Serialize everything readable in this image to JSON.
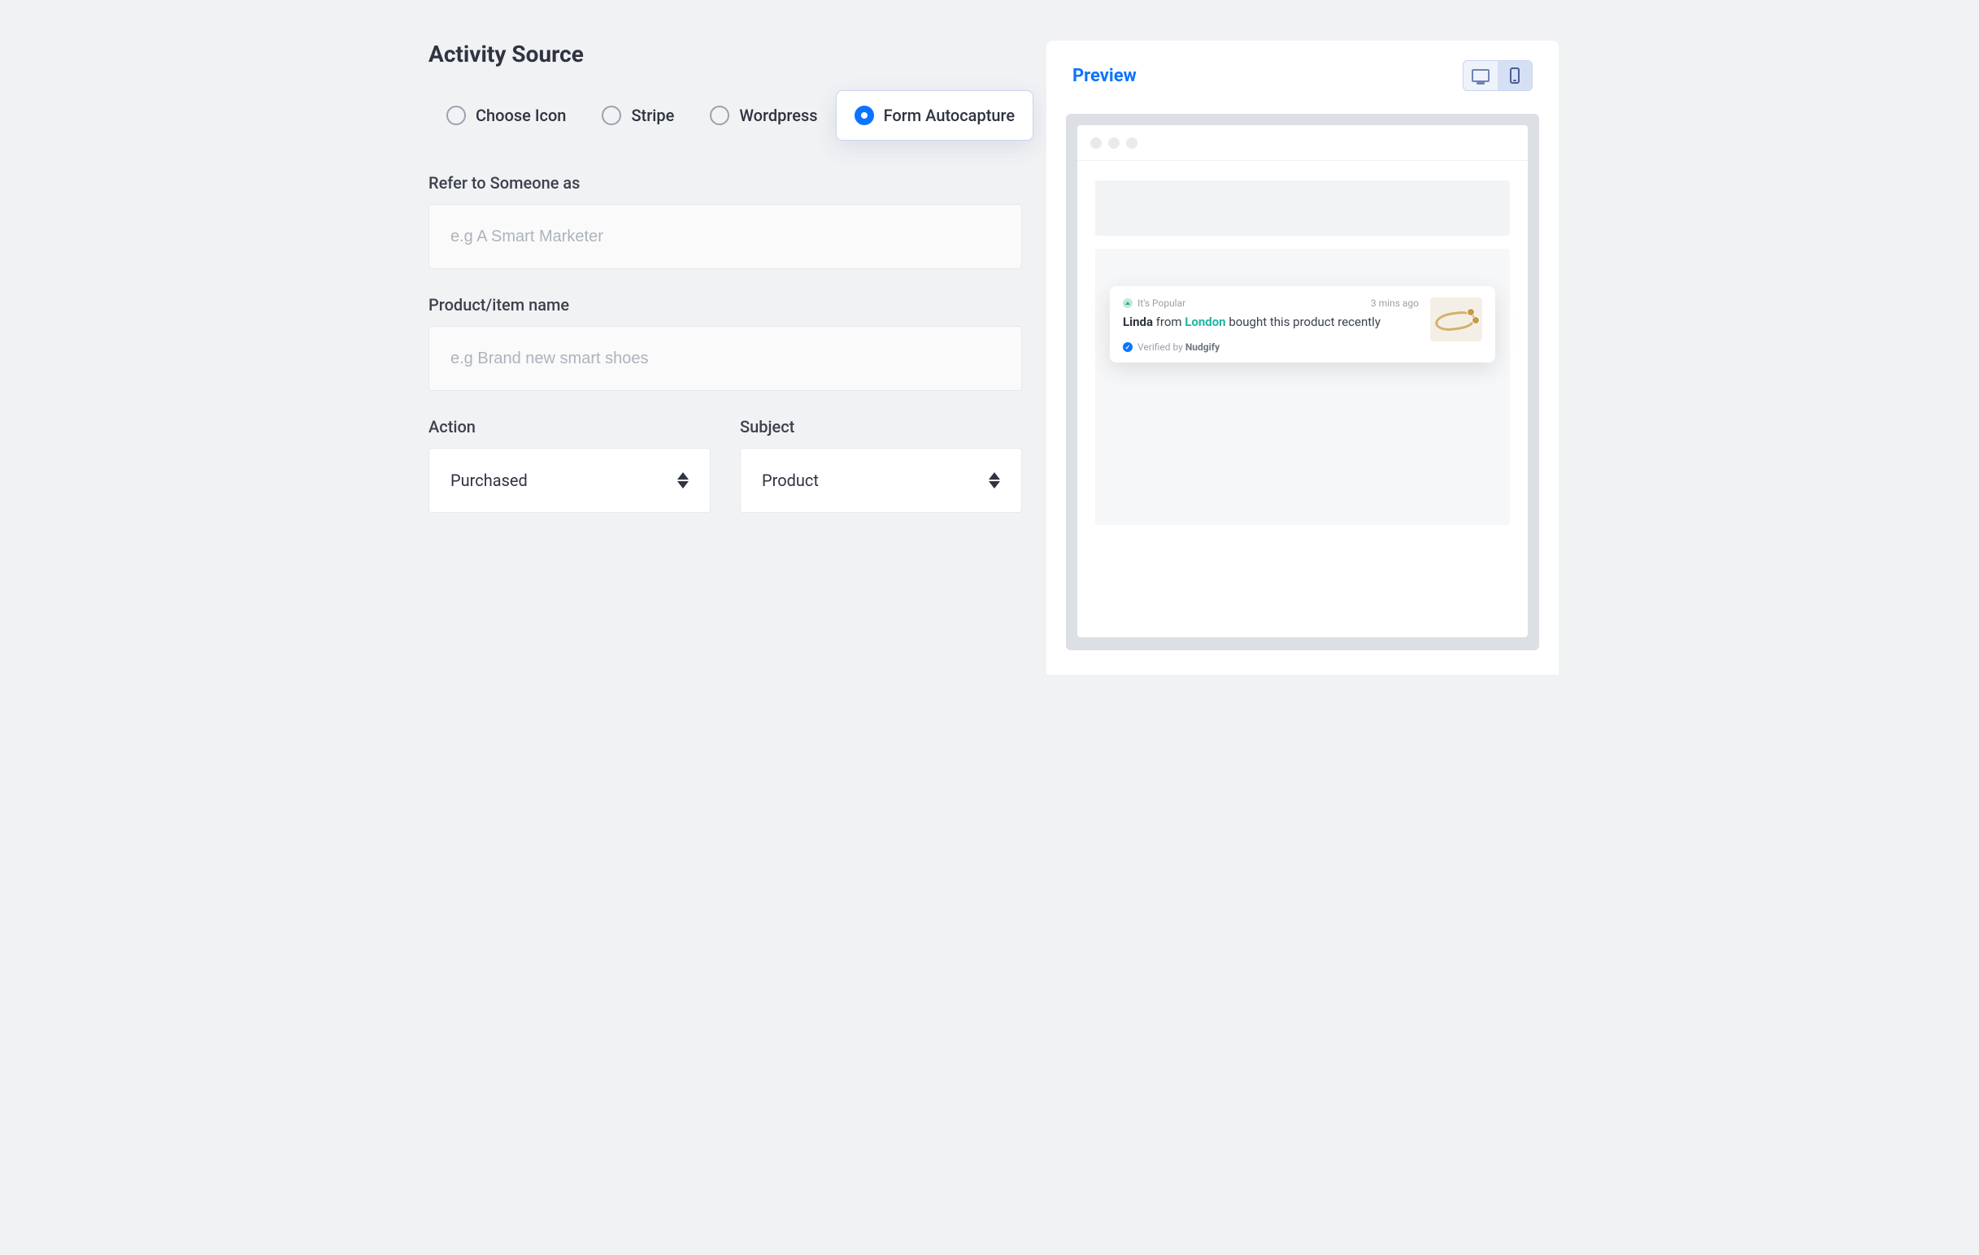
{
  "title": "Activity Source",
  "sources": {
    "choose_icon": "Choose Icon",
    "stripe": "Stripe",
    "wordpress": "Wordpress",
    "form_autocapture": "Form Autocapture"
  },
  "fields": {
    "refer_label": "Refer to Someone as",
    "refer_placeholder": "e.g A Smart Marketer",
    "product_label": "Product/item name",
    "product_placeholder": "e.g Brand new smart shoes",
    "action_label": "Action",
    "action_value": "Purchased",
    "subject_label": "Subject",
    "subject_value": "Product"
  },
  "preview": {
    "heading": "Preview",
    "popular": "It's Popular",
    "time": "3 mins ago",
    "name": "Linda",
    "from": " from ",
    "city": "London",
    "tail": " bought this product recently",
    "verified_prefix": "Verified by ",
    "verified_brand": "Nudgify"
  }
}
